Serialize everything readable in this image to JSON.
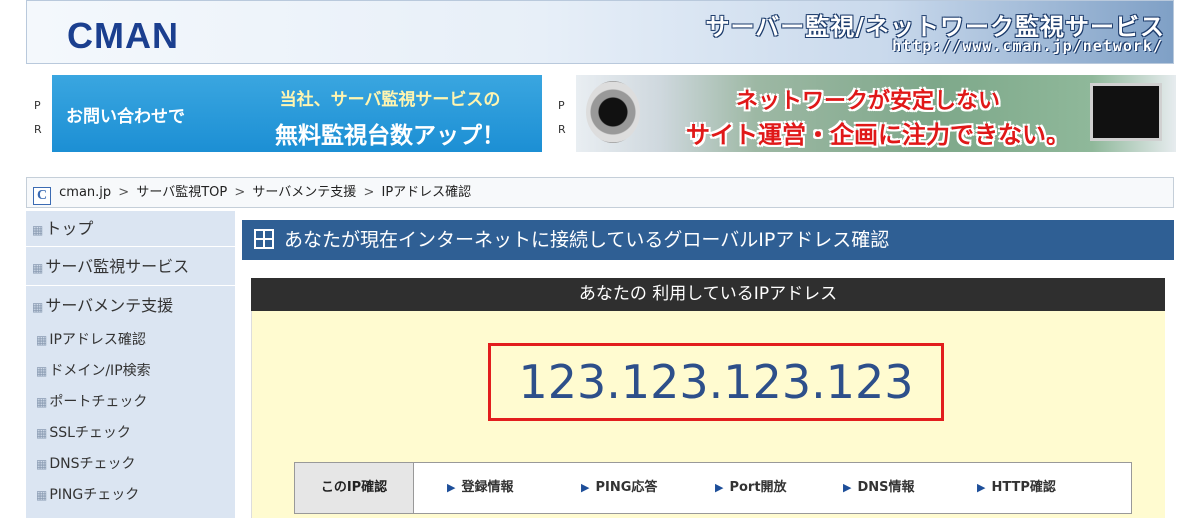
{
  "header": {
    "logo": "CMAN",
    "title": "サーバー監視/ネットワーク監視サービス",
    "url": "http://www.cman.jp/network/"
  },
  "pr": {
    "p": "P",
    "r": "R"
  },
  "banner_left": {
    "left_text": "お問い合わせで",
    "right_line1": "当社、サーバ監視サービスの",
    "right_line2": "無料監視台数アップ！"
  },
  "banner_right": {
    "line1": "ネットワークが安定しない",
    "line2": "サイト運営・企画に注力できない。"
  },
  "breadcrumb": {
    "icon": "C",
    "items": [
      "cman.jp",
      "サーバ監視TOP",
      "サーバメンテ支援",
      "IPアドレス確認"
    ],
    "separator": ">"
  },
  "sidebar": {
    "items": [
      {
        "label": "トップ"
      },
      {
        "label": "サーバ監視サービス"
      },
      {
        "label": "サーバメンテ支援"
      },
      {
        "label": "IPアドレス確認"
      },
      {
        "label": "ドメイン/IP検索"
      },
      {
        "label": "ポートチェック"
      },
      {
        "label": "SSLチェック"
      },
      {
        "label": "DNSチェック"
      },
      {
        "label": "PINGチェック"
      }
    ]
  },
  "main": {
    "title": "あなたが現在インターネットに接続しているグローバルIPアドレス確認",
    "ip_header": "あなたの 利用しているIPアドレス",
    "ip_value": "123.123.123.123",
    "check_label": "このIP確認",
    "check_links": [
      "登録情報",
      "PING応答",
      "Port開放",
      "DNS情報",
      "HTTP確認"
    ]
  },
  "colors": {
    "title_bar": "#2f5f94",
    "ip_box_border": "#e21d1d",
    "ip_text": "#2d4f8a",
    "ip_background": "#fffbd0"
  }
}
